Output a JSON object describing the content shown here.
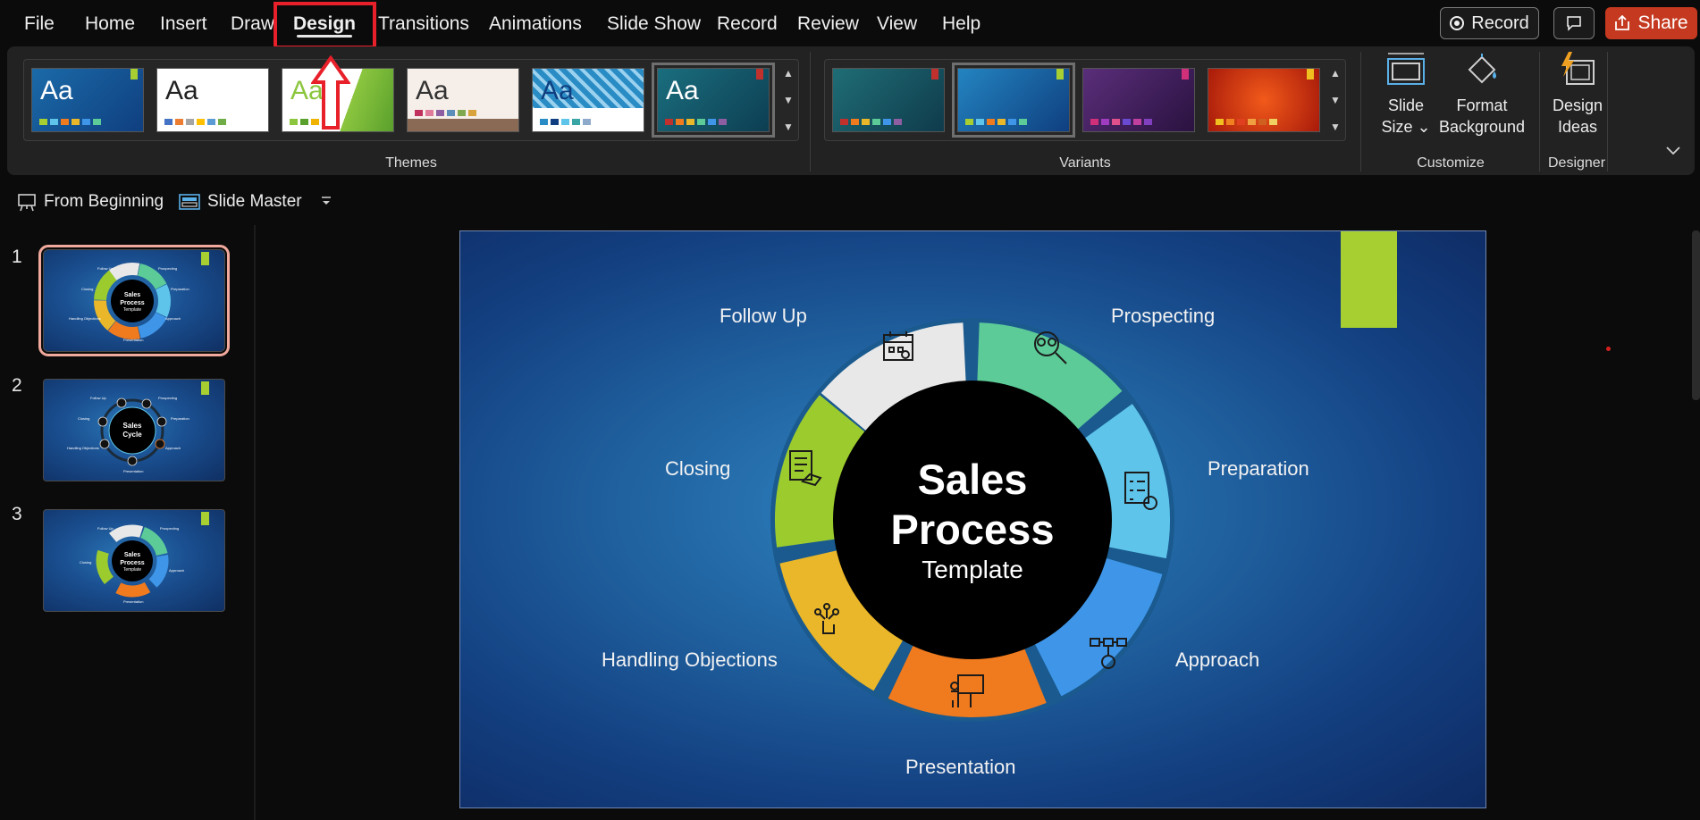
{
  "menu": {
    "tabs": [
      {
        "label": "File"
      },
      {
        "label": "Home"
      },
      {
        "label": "Insert"
      },
      {
        "label": "Draw"
      },
      {
        "label": "Design"
      },
      {
        "label": "Transitions"
      },
      {
        "label": "Animations"
      },
      {
        "label": "Slide Show"
      },
      {
        "label": "Record"
      },
      {
        "label": "Review"
      },
      {
        "label": "View"
      },
      {
        "label": "Help"
      }
    ],
    "active_tab": "Design",
    "record_button": "Record",
    "share_button": "Share"
  },
  "ribbon": {
    "themes": {
      "group_label": "Themes",
      "thumb_text": "Aa",
      "items": [
        {
          "name": "theme-1",
          "selected": false
        },
        {
          "name": "theme-2",
          "selected": false
        },
        {
          "name": "theme-3",
          "selected": false
        },
        {
          "name": "theme-4",
          "selected": false
        },
        {
          "name": "theme-5",
          "selected": false
        },
        {
          "name": "theme-6",
          "selected": true
        }
      ]
    },
    "variants": {
      "group_label": "Variants",
      "items": [
        {
          "name": "variant-1",
          "selected": false
        },
        {
          "name": "variant-2",
          "selected": true
        },
        {
          "name": "variant-3",
          "selected": false
        },
        {
          "name": "variant-4",
          "selected": false
        }
      ]
    },
    "customize": {
      "group_label": "Customize",
      "slide_size_line1": "Slide",
      "slide_size_line2": "Size",
      "format_bg_line1": "Format",
      "format_bg_line2": "Background"
    },
    "designer": {
      "group_label": "Designer",
      "design_ideas_line1": "Design",
      "design_ideas_line2": "Ideas"
    }
  },
  "quick_access": {
    "from_beginning": "From Beginning",
    "slide_master": "Slide Master"
  },
  "slides_panel": {
    "slides": [
      {
        "number": "1",
        "selected": true,
        "title_line1": "Sales",
        "title_line2": "Process",
        "title_line3": "Template"
      },
      {
        "number": "2",
        "selected": false,
        "title_line1": "Sales",
        "title_line2": "Cycle",
        "title_line3": ""
      },
      {
        "number": "3",
        "selected": false,
        "title_line1": "Sales",
        "title_line2": "Process",
        "title_line3": "Template"
      }
    ]
  },
  "slide": {
    "title_line1": "Sales",
    "title_line2": "Process",
    "subtitle": "Template",
    "stages": {
      "follow_up": "Follow Up",
      "prospecting": "Prospecting",
      "preparation": "Preparation",
      "approach": "Approach",
      "presentation": "Presentation",
      "handling_objections": "Handling Objections",
      "closing": "Closing"
    },
    "colors": {
      "follow_up": "#e8e8e8",
      "prospecting": "#5ccb98",
      "preparation": "#5ec4ea",
      "approach": "#3f96e8",
      "presentation": "#f07a1e",
      "handling_objections": "#eab62a",
      "closing": "#9ccb2e",
      "accent": "#a8cf32"
    }
  }
}
